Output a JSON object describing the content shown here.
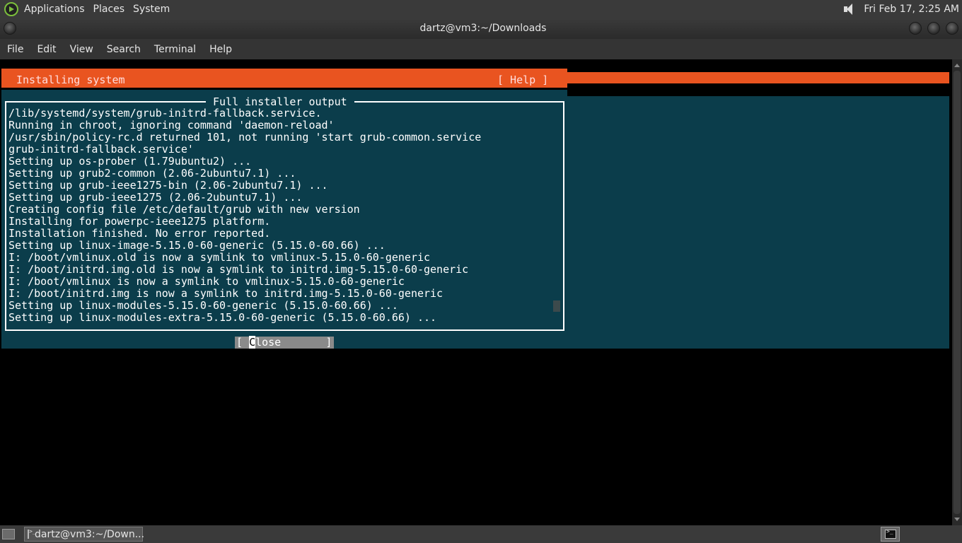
{
  "top_panel": {
    "menus": [
      "Applications",
      "Places",
      "System"
    ],
    "clock": "Fri Feb 17,  2:25 AM"
  },
  "window": {
    "title": "dartz@vm3:~/Downloads"
  },
  "menubar": [
    "File",
    "Edit",
    "View",
    "Search",
    "Terminal",
    "Help"
  ],
  "installer": {
    "header_title": "Installing system",
    "help_label": "[ Help ]",
    "output_title": "Full installer output",
    "close_label": "Close",
    "accent_color": "#e95420",
    "background_color": "#0b3d4b",
    "output_lines": [
      "/lib/systemd/system/grub-initrd-fallback.service.",
      "Running in chroot, ignoring command 'daemon-reload'",
      "/usr/sbin/policy-rc.d returned 101, not running 'start grub-common.service",
      "grub-initrd-fallback.service'",
      "Setting up os-prober (1.79ubuntu2) ...",
      "Setting up grub2-common (2.06-2ubuntu7.1) ...",
      "Setting up grub-ieee1275-bin (2.06-2ubuntu7.1) ...",
      "Setting up grub-ieee1275 (2.06-2ubuntu7.1) ...",
      "Creating config file /etc/default/grub with new version",
      "Installing for powerpc-ieee1275 platform.",
      "Installation finished. No error reported.",
      "Setting up linux-image-5.15.0-60-generic (5.15.0-60.66) ...",
      "I: /boot/vmlinux.old is now a symlink to vmlinux-5.15.0-60-generic",
      "I: /boot/initrd.img.old is now a symlink to initrd.img-5.15.0-60-generic",
      "I: /boot/vmlinux is now a symlink to vmlinux-5.15.0-60-generic",
      "I: /boot/initrd.img is now a symlink to initrd.img-5.15.0-60-generic",
      "Setting up linux-modules-5.15.0-60-generic (5.15.0-60.66) ...",
      "Setting up linux-modules-extra-5.15.0-60-generic (5.15.0-60.66) ..."
    ]
  },
  "taskbar": {
    "task_label": "dartz@vm3:~/Down..."
  }
}
